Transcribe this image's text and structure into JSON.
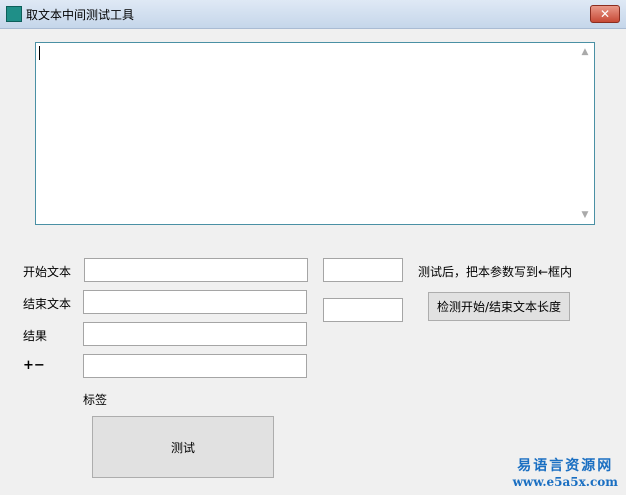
{
  "window": {
    "title": "取文本中间测试工具",
    "close_glyph": "✕",
    "icon": "app-icon"
  },
  "memo": {
    "value": "",
    "scroll_up_glyph": "▲",
    "scroll_down_glyph": "▼"
  },
  "form": {
    "start_label": "开始文本",
    "start_value": "",
    "end_label": "结束文本",
    "end_value": "",
    "result_label": "结果",
    "result_value": "",
    "plusminus_label": "+−",
    "plusminus_value": "",
    "tag_label": "标签",
    "param_top_value": "",
    "param_bottom_value": "",
    "hint_text": "测试后，把本参数写到←框内",
    "check_button_label": "检测开始/结束文本长度",
    "test_button_label": "测试"
  },
  "watermark": {
    "line1": "易语言资源网",
    "line2": "www.e5a5x.com"
  }
}
